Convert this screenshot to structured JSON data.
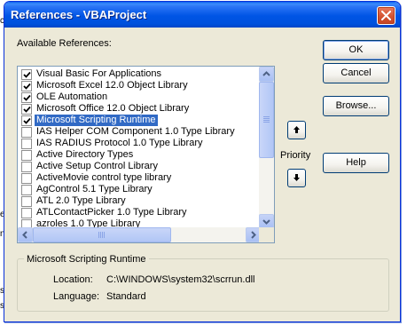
{
  "window": {
    "title": "References - VBAProject",
    "close_icon": "close-icon"
  },
  "available_label": "Available References:",
  "references": [
    {
      "label": "Visual Basic For Applications",
      "checked": true,
      "selected": false
    },
    {
      "label": "Microsoft Excel 12.0 Object Library",
      "checked": true,
      "selected": false
    },
    {
      "label": "OLE Automation",
      "checked": true,
      "selected": false
    },
    {
      "label": "Microsoft Office 12.0 Object Library",
      "checked": true,
      "selected": false
    },
    {
      "label": "Microsoft Scripting Runtime",
      "checked": true,
      "selected": true
    },
    {
      "label": "IAS Helper COM Component 1.0 Type Library",
      "checked": false,
      "selected": false
    },
    {
      "label": "IAS RADIUS Protocol 1.0 Type Library",
      "checked": false,
      "selected": false
    },
    {
      "label": "Active Directory Types",
      "checked": false,
      "selected": false
    },
    {
      "label": "Active Setup Control Library",
      "checked": false,
      "selected": false
    },
    {
      "label": "ActiveMovie control type library",
      "checked": false,
      "selected": false
    },
    {
      "label": "AgControl 5.1 Type Library",
      "checked": false,
      "selected": false
    },
    {
      "label": "ATL 2.0 Type Library",
      "checked": false,
      "selected": false
    },
    {
      "label": "ATLContactPicker 1.0 Type Library",
      "checked": false,
      "selected": false
    },
    {
      "label": "azroles 1.0 Type Library",
      "checked": false,
      "selected": false
    }
  ],
  "buttons": {
    "ok": "OK",
    "cancel": "Cancel",
    "browse": "Browse...",
    "help": "Help"
  },
  "priority": {
    "label": "Priority",
    "up_icon": "arrow-up-icon",
    "down_icon": "arrow-down-icon"
  },
  "details": {
    "group_title": "Microsoft Scripting Runtime",
    "location_label": "Location:",
    "location_value": "C:\\WINDOWS\\system32\\scrrun.dll",
    "language_label": "Language:",
    "language_value": "Standard"
  },
  "colors": {
    "title_bar": "#0055e5",
    "selection": "#316ac5",
    "dialog_bg": "#ece9d8",
    "close_button": "#d2512f"
  }
}
